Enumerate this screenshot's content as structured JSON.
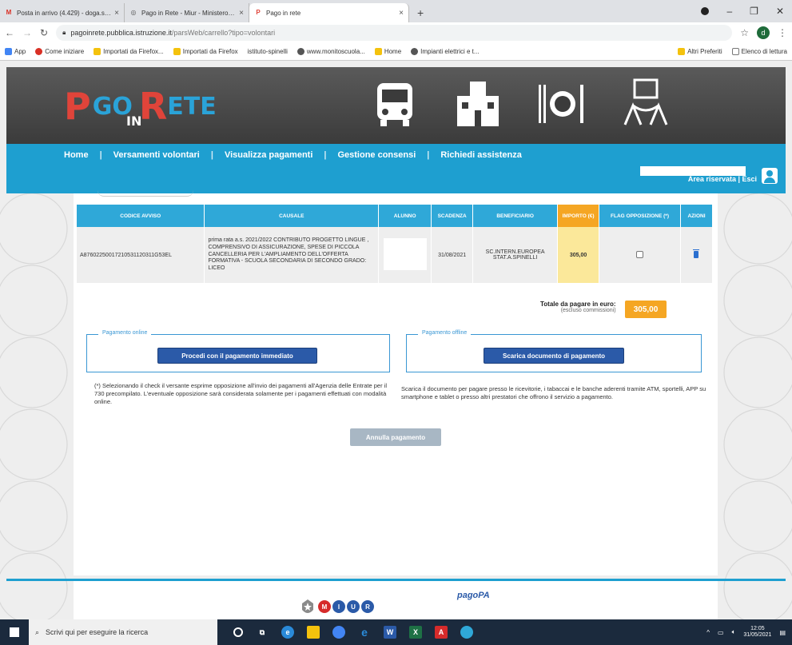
{
  "browser": {
    "tabs": [
      {
        "title": "Posta in arrivo (4.429) - doga.sc...",
        "favicon": "gmail-icon",
        "color": "#d93025",
        "glyph": "M"
      },
      {
        "title": "Pago in Rete - Miur - Ministero d...",
        "favicon": "globe-icon",
        "color": "#555555",
        "glyph": "◎"
      },
      {
        "title": "Pago in rete",
        "favicon": "pagoinrete-icon",
        "color": "#e0443a",
        "glyph": "P"
      }
    ],
    "url_host": "pagoinrete.pubblica.istruzione.it",
    "url_path": "/parsWeb/carrello?tipo=volontari",
    "bookmarks": [
      {
        "label": "App",
        "color": "#4285f4"
      },
      {
        "label": "Come iniziare",
        "color": "#d93025"
      },
      {
        "label": "Importati da Firefox...",
        "color": "#f4c20d"
      },
      {
        "label": "Importati da Firefox",
        "color": "#f4c20d"
      },
      {
        "label": "istituto-spinelli",
        "color": "#888888"
      },
      {
        "label": "www.monitoscuola...",
        "color": "#555555"
      },
      {
        "label": "Home",
        "color": "#f4c20d"
      },
      {
        "label": "Impianti elettrici e t...",
        "color": "#555555"
      }
    ],
    "bookmarks_right": [
      {
        "label": "Altri Preferiti",
        "color": "#f4c20d"
      },
      {
        "label": "Elenco di lettura",
        "color": "#777777"
      }
    ]
  },
  "site": {
    "logo": {
      "p": "P",
      "go": "GO",
      "in": "IN",
      "r": "R",
      "ete": "ETE"
    },
    "nav": [
      "Home",
      "Versamenti volontari",
      "Visualizza pagamenti",
      "Gestione consensi",
      "Richiedi assistenza"
    ],
    "area": "Area riservata | Esci"
  },
  "table": {
    "headers": [
      "CODICE AVVISO",
      "CAUSALE",
      "ALUNNO",
      "SCADENZA",
      "BENEFICIARIO",
      "IMPORTO (€)",
      "FLAG OPPOSIZIONE (*)",
      "AZIONI"
    ],
    "row": {
      "codice": "A87602250017210531120311G53EL",
      "causale": "prima rata a.s. 2021/2022 CONTRIBUTO PROGETTO LINGUE , COMPRENSIVO DI ASSICURAZIONE, SPESE DI PICCOLA CANCELLERIA PER L'AMPLIAMENTO DELL'OFFERTA FORMATIVA - SCUOLA SECONDARIA DI SECONDO GRADO: LICEO",
      "alunno": "",
      "scadenza": "31/08/2021",
      "beneficiario": "SC.INTERN.EUROPEA STAT.A.SPINELLI",
      "importo": "305,00"
    }
  },
  "totale": {
    "label": "Totale da pagare in euro:",
    "sub": "(escluso commissioni)",
    "value": "305,00"
  },
  "online": {
    "legend": "Pagamento online",
    "button": "Procedi con il pagamento immediato",
    "note": "(*) Selezionando il check il versante esprime opposizione all'invio dei pagamenti all'Agenzia delle Entrate per il 730 precompilato. L'eventuale opposizione sarà considerata solamente per i pagamenti effettuati con modalità online."
  },
  "offline": {
    "legend": "Pagamento offline",
    "button": "Scarica documento di pagamento",
    "note": "Scarica il documento per pagare presso le ricevitorie, i tabaccai e le banche aderenti tramite ATM, sportelli, APP su smartphone e tablet o presso altri prestatori che offrono il servizio a pagamento."
  },
  "annulla": "Annulla pagamento",
  "footer": {
    "circles": [
      "M",
      "I",
      "U",
      "R"
    ],
    "pagopa": "pagoPA"
  },
  "taskbar": {
    "search": "Scrivi qui per eseguire la ricerca",
    "time": "12:05",
    "date": "31/05/2021"
  },
  "colors": {
    "primary": "#1e9fd0",
    "header": "#2fa8d8",
    "amount": "#f5a623",
    "button": "#2b5aa8"
  }
}
